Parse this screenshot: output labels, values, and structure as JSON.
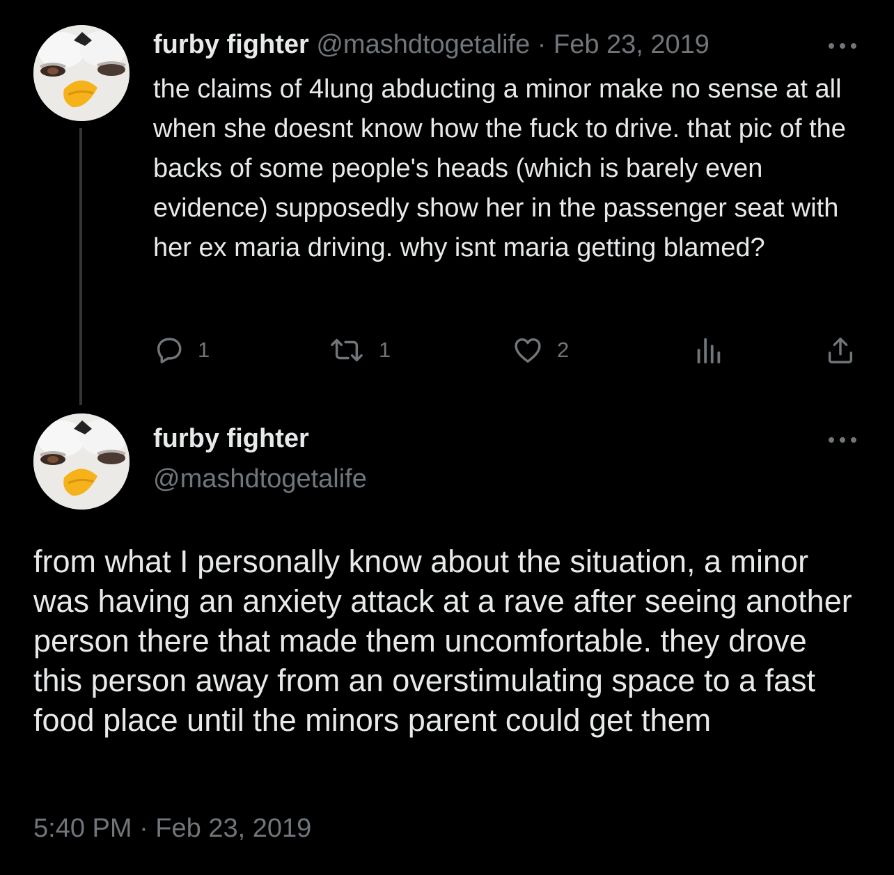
{
  "tweet": {
    "author_name": "furby fighter",
    "author_handle": "@mashdtogetalife",
    "separator": "·",
    "date": "Feb 23, 2019",
    "text": "the claims of 4lung abducting a minor make no sense at all when she doesnt know how the fuck to drive. that pic of the backs of some people's heads (which is barely even evidence) supposedly show her in the passenger seat with her ex maria driving. why isnt maria getting blamed?",
    "actions": {
      "replies": "1",
      "retweets": "1",
      "likes": "2"
    }
  },
  "reply": {
    "author_name": "furby fighter",
    "author_handle": "@mashdtogetalife",
    "text": "from what I personally know about the situation, a minor was having an anxiety attack at a rave after seeing another person there that made them uncomfortable. they drove this person away from an overstimulating space to a fast food place until the minors parent could get them",
    "timestamp": "5:40 PM · Feb 23, 2019"
  },
  "icons": {
    "avatar": "furby-avatar",
    "more": "more-options-icon",
    "reply": "reply-icon",
    "retweet": "retweet-icon",
    "like": "heart-icon",
    "views": "views-icon",
    "share": "share-icon"
  },
  "colors": {
    "background": "#000000",
    "text": "#e7e9ea",
    "muted": "#71767b",
    "thread_line": "#333639"
  }
}
